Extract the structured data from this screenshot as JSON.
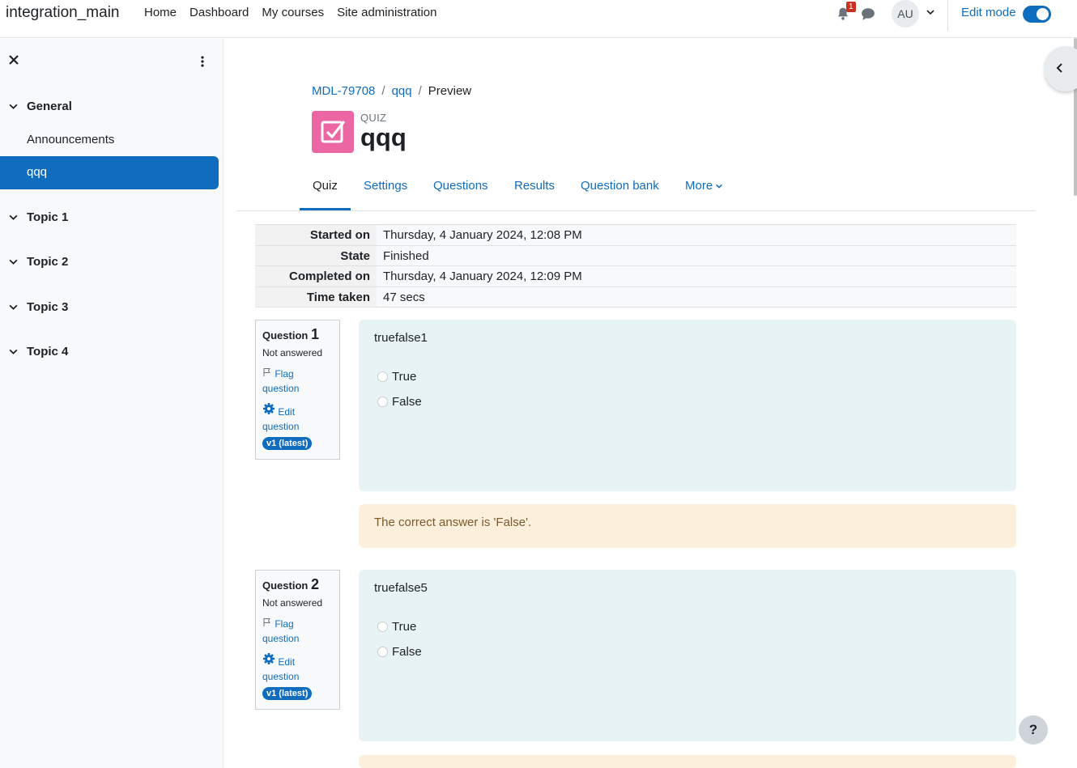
{
  "navbar": {
    "brand": "integration_main",
    "links": [
      "Home",
      "Dashboard",
      "My courses",
      "Site administration"
    ],
    "notification_count": "1",
    "avatar_initials": "AU",
    "edit_mode_label": "Edit mode"
  },
  "drawer": {
    "sections": [
      {
        "label": "General"
      },
      {
        "label": "Topic 1"
      },
      {
        "label": "Topic 2"
      },
      {
        "label": "Topic 3"
      },
      {
        "label": "Topic 4"
      }
    ],
    "activities": [
      "Announcements",
      "qqq"
    ]
  },
  "breadcrumb": [
    "MDL-79708",
    "qqq",
    "Preview"
  ],
  "header": {
    "pretitle": "QUIZ",
    "title": "qqq"
  },
  "tabs": [
    "Quiz",
    "Settings",
    "Questions",
    "Results",
    "Question bank",
    "More"
  ],
  "summary": [
    {
      "label": "Started on",
      "value": "Thursday, 4 January 2024, 12:08 PM"
    },
    {
      "label": "State",
      "value": "Finished"
    },
    {
      "label": "Completed on",
      "value": "Thursday, 4 January 2024, 12:09 PM"
    },
    {
      "label": "Time taken",
      "value": "47 secs"
    }
  ],
  "questions": [
    {
      "label": "Question",
      "number": "1",
      "state": "Not answered",
      "flag": "Flag question",
      "edit": "Edit question",
      "version": "v1 (latest)",
      "text": "truefalse1",
      "answers": [
        "True",
        "False"
      ],
      "feedback": "The correct answer is 'False'."
    },
    {
      "label": "Question",
      "number": "2",
      "state": "Not answered",
      "flag": "Flag question",
      "edit": "Edit question",
      "version": "v1 (latest)",
      "text": "truefalse5",
      "answers": [
        "True",
        "False"
      ],
      "feedback": ""
    }
  ],
  "help_label": "?",
  "colors": {
    "primary": "#0f6cbf",
    "quiz_icon": "#eb66a2",
    "question_bg": "#e7f3f5",
    "feedback_bg": "#fcefdc"
  }
}
